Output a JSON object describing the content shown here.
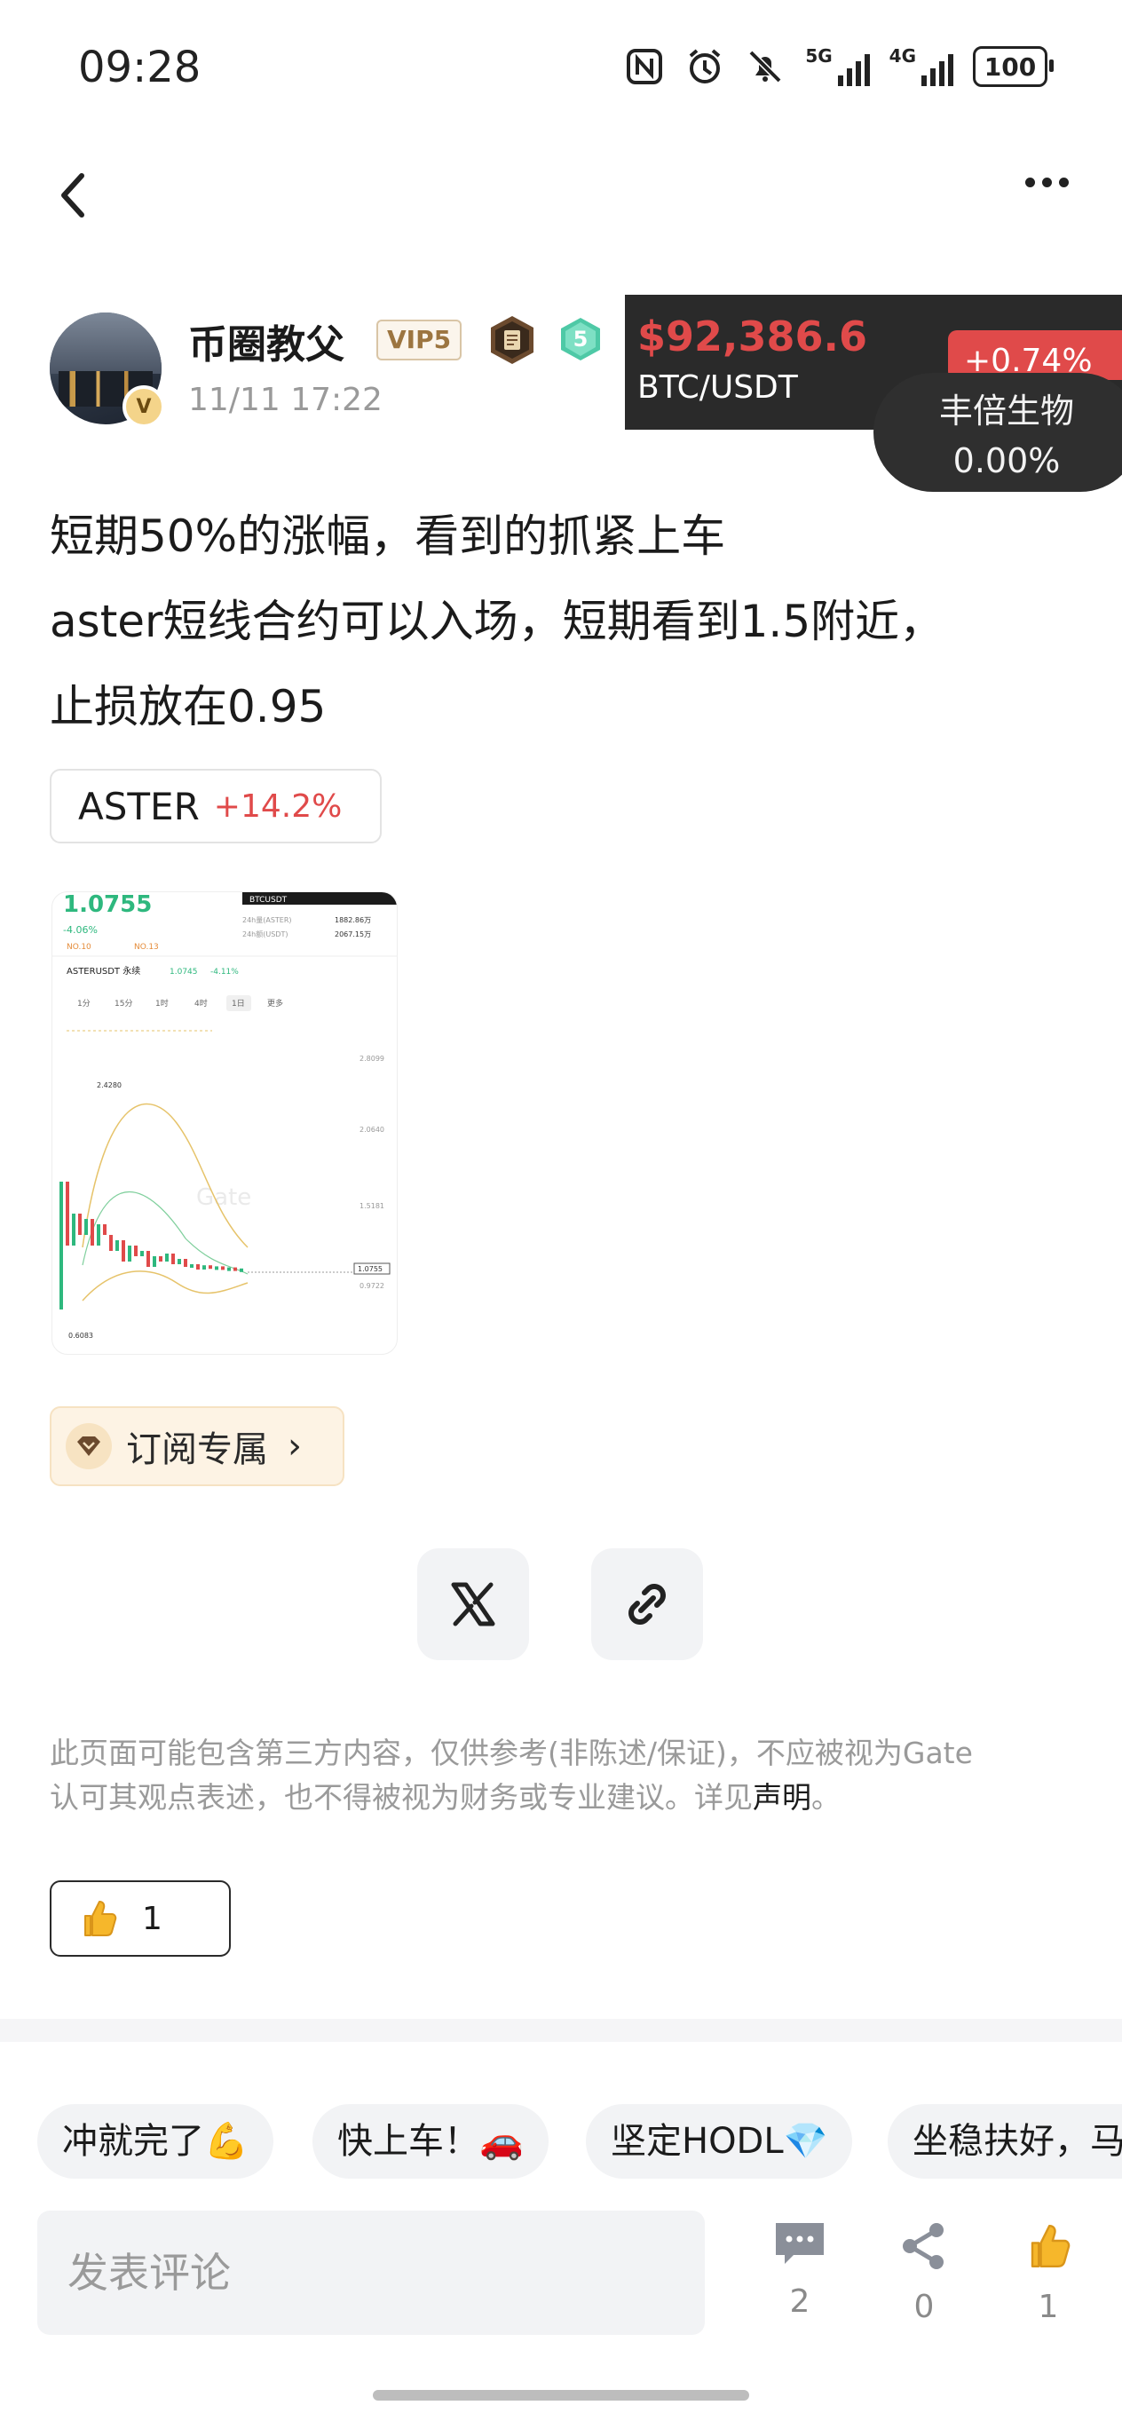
{
  "status_bar": {
    "time": "09:28",
    "signal_1_label": "5G",
    "signal_2_label": "4G",
    "battery": "100",
    "icons": [
      "nfc-icon",
      "alarm-icon",
      "mute-icon",
      "signal-5g-icon",
      "signal-4g-icon",
      "battery-icon"
    ]
  },
  "nav": {
    "back_icon": "chevron-left-icon",
    "more_icon": "more-dots-icon"
  },
  "author": {
    "name": "币圈教父",
    "vip_badge": "VIP5",
    "level": "5",
    "verified_mark": "V",
    "post_time": "11/11 17:22"
  },
  "ticker": {
    "price": "$92,386.6",
    "pair": "BTC/USDT",
    "change": "+0.74%",
    "bubble_name": "丰倍生物",
    "bubble_change": "0.00%"
  },
  "post": {
    "lines": [
      "短期50%的涨幅，看到的抓紧上车",
      "aster短线合约可以入场，短期看到1.5附近，",
      "止损放在0.95"
    ]
  },
  "coin_tag": {
    "symbol": "ASTER",
    "change": "+14.2%"
  },
  "thumbnail": {
    "price": "1.0755",
    "change": "-4.06%",
    "pair_label": "ASTERUSDT 永续",
    "pair_price": "1.0745",
    "pair_change": "-4.11%",
    "btc_tab": "BTCUSDT",
    "vol_label_1": "24h量(ASTER)",
    "vol_value_1": "1882.86万",
    "vol_label_2": "24h额(USDT)",
    "vol_value_2": "2067.15万",
    "rank_1": "NO.10",
    "rank_2": "NO.13",
    "timeframes": [
      "1分",
      "15分",
      "1时",
      "4时",
      "1日",
      "更多"
    ],
    "high_label": "2.4280",
    "low_label": "0.6083",
    "axis": [
      "2.8099",
      "2.0640",
      "1.5181",
      "1.0755",
      "0.9722"
    ],
    "watermark": "Gate"
  },
  "subscribe": {
    "label": "订阅专属",
    "chevron": "›"
  },
  "share": {
    "x_icon": "x-logo-icon",
    "link_icon": "link-icon"
  },
  "disclaimer": {
    "text_1": "此页面可能包含第三方内容，仅供参考(非陈述/保证)，不应被视为Gate",
    "text_2": "认可其观点表述，也不得被视为财务或专业建议。详见",
    "link": "声明",
    "end": "。"
  },
  "like": {
    "count": "1"
  },
  "quick_replies": [
    "冲就完了💪",
    "快上车！🚗",
    "坚定HODL💎",
    "坐稳扶好，马"
  ],
  "comment": {
    "placeholder": "发表评论",
    "comments_count": "2",
    "shares_count": "0",
    "likes_count": "1"
  },
  "colors": {
    "up_red": "#e04a4a",
    "ticker_bg": "#2a2a2a",
    "vip_gold": "#9c7540",
    "level_green": "#4ec9a6"
  }
}
